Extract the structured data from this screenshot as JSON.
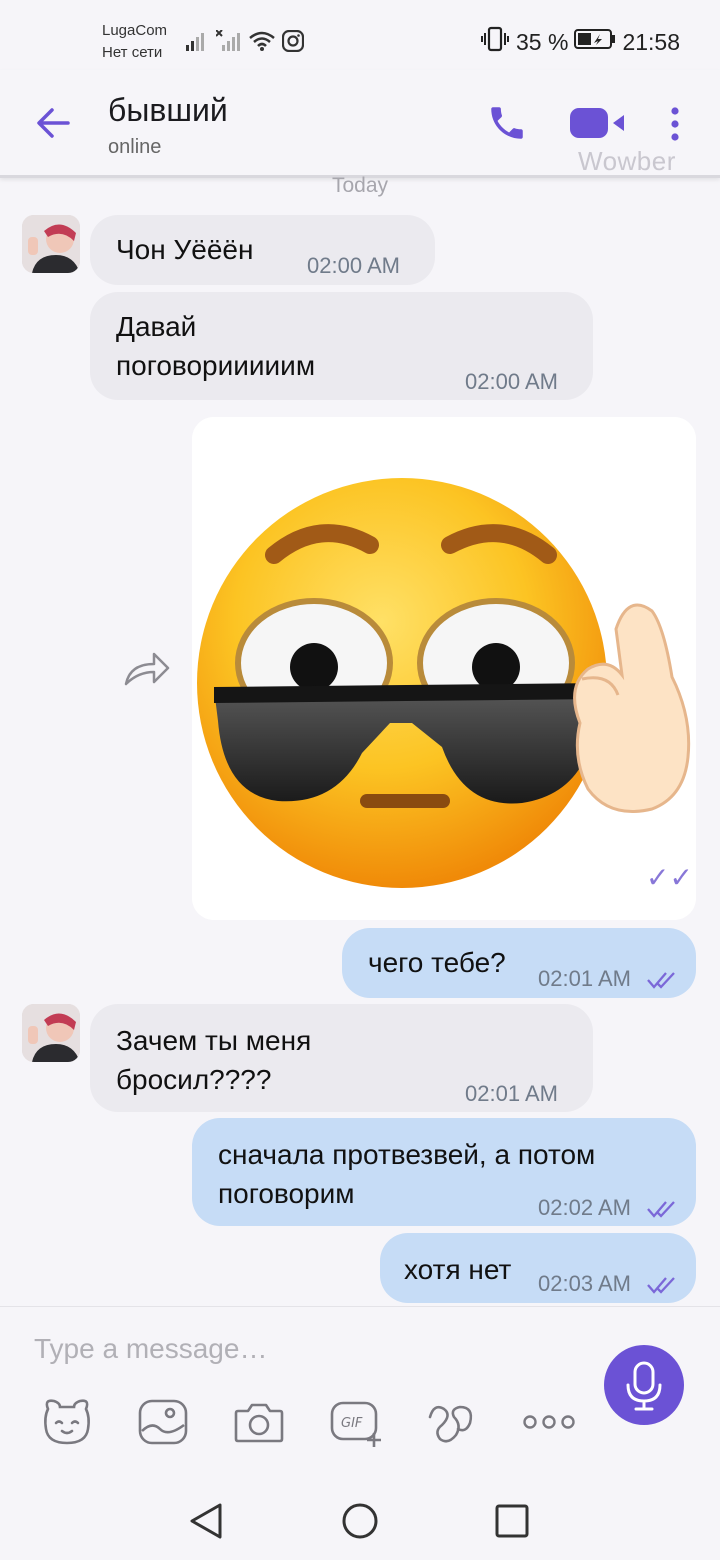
{
  "status_bar": {
    "carrier": "LugaCom",
    "network": "Нет сети",
    "battery": "35 %",
    "time": "21:58"
  },
  "header": {
    "contact_name": "бывший",
    "presence": "online",
    "watermark": "Wowber"
  },
  "chat": {
    "date_separator": "Today",
    "messages": [
      {
        "direction": "in",
        "text": "Чон Уёёён",
        "time": "02:00 AM"
      },
      {
        "direction": "in",
        "text_lines": [
          "Давай",
          "поговорииииим"
        ],
        "time": "02:00 AM"
      },
      {
        "direction": "out",
        "type": "image",
        "image": "emoji-sunglasses-sticker",
        "status": "read"
      },
      {
        "direction": "out",
        "text": "чего тебе?",
        "time": "02:01 AM",
        "status": "read"
      },
      {
        "direction": "in",
        "text_lines": [
          "Зачем ты меня",
          "бросил????"
        ],
        "time": "02:01 AM"
      },
      {
        "direction": "out",
        "text_lines": [
          "сначала протвезвей, а потом",
          "поговорим"
        ],
        "time": "02:02 AM",
        "status": "read"
      },
      {
        "direction": "out",
        "text": "хотя нет",
        "time": "02:03 AM",
        "status": "read"
      }
    ]
  },
  "composer": {
    "placeholder": "Type a message…",
    "tools": [
      "sticker-icon",
      "gallery-icon",
      "camera-icon",
      "gif-icon",
      "doodle-icon",
      "more-icon"
    ]
  },
  "colors": {
    "accent": "#6b52d5",
    "incoming_bubble": "#ebeaef",
    "outgoing_bubble": "#c6dcf6",
    "background": "#f6f5f9"
  }
}
